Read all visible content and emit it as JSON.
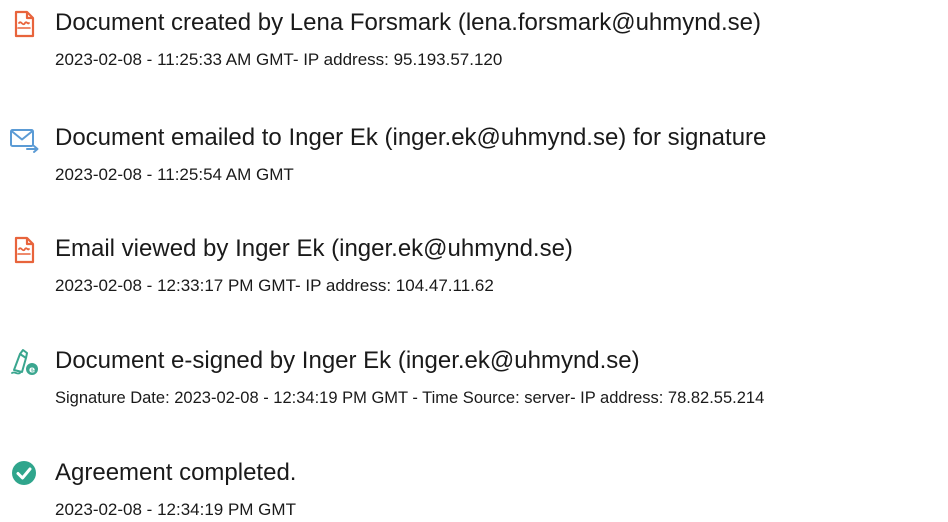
{
  "events": [
    {
      "icon": "document-icon",
      "title": "Document created by Lena Forsmark (lena.forsmark@uhmynd.se)",
      "detail": "2023-02-08 - 11:25:33 AM GMT- IP address: 95.193.57.120"
    },
    {
      "icon": "email-forward-icon",
      "title": "Document emailed to Inger Ek (inger.ek@uhmynd.se) for signature",
      "detail": "2023-02-08 - 11:25:54 AM GMT"
    },
    {
      "icon": "document-icon",
      "title": "Email viewed by Inger Ek (inger.ek@uhmynd.se)",
      "detail": "2023-02-08 - 12:33:17 PM GMT- IP address: 104.47.11.62"
    },
    {
      "icon": "pen-signature-icon",
      "title": "Document e-signed by Inger Ek (inger.ek@uhmynd.se)",
      "detail": "Signature Date: 2023-02-08 - 12:34:19 PM GMT - Time Source: server- IP address: 78.82.55.214"
    },
    {
      "icon": "check-circle-icon",
      "title": "Agreement completed.",
      "detail": "2023-02-08 - 12:34:19 PM GMT"
    }
  ],
  "colors": {
    "document_icon": "#e8643c",
    "email_icon": "#5b9bd5",
    "signature_icon": "#3aa68f",
    "check_icon": "#2fa58c",
    "text": "#1a1a1a"
  }
}
